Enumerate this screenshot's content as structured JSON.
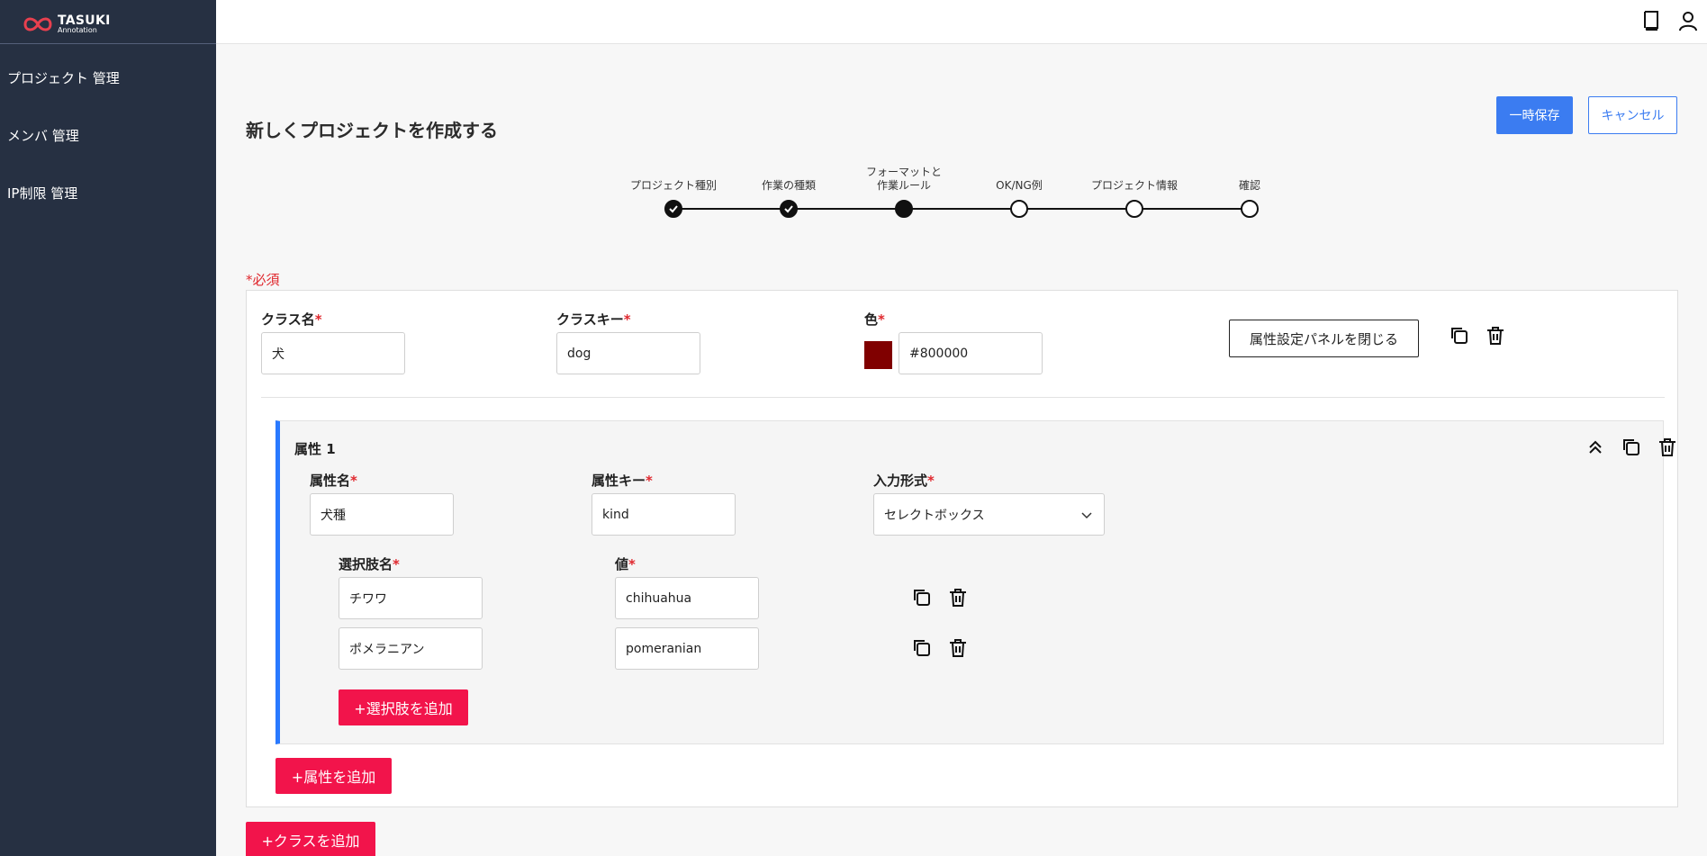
{
  "app": {
    "logo_main": "TASUKI",
    "logo_sub": "Annotation"
  },
  "sidebar": {
    "items": [
      {
        "label": "プロジェクト 管理"
      },
      {
        "label": "メンバ 管理"
      },
      {
        "label": "IP制限 管理"
      }
    ]
  },
  "header": {
    "icons": [
      "book-icon",
      "user-icon"
    ]
  },
  "page": {
    "title": "新しくプロジェクトを作成する",
    "save_label": "一時保存",
    "cancel_label": "キャンセル",
    "required_note": "*必須"
  },
  "stepper": {
    "steps": [
      {
        "label": "プロジェクト種別",
        "state": "done"
      },
      {
        "label": "作業の種類",
        "state": "done"
      },
      {
        "label_line1": "フォーマットと",
        "label_line2": "作業ルール",
        "state": "current"
      },
      {
        "label": "OK/NG例",
        "state": "todo"
      },
      {
        "label": "プロジェクト情報",
        "state": "todo"
      },
      {
        "label": "確認",
        "state": "todo"
      }
    ]
  },
  "class_card": {
    "class_name_label": "クラス名",
    "class_name_value": "犬",
    "class_key_label": "クラスキー",
    "class_key_value": "dog",
    "color_label": "色",
    "color_value": "#800000",
    "close_panel_label": "属性設定パネルを閉じる",
    "required_mark": "*",
    "attribute": {
      "title": "属性 1",
      "name_label": "属性名",
      "name_value": "犬種",
      "key_label": "属性キー",
      "key_value": "kind",
      "input_type_label": "入力形式",
      "input_type_value": "セレクトボックス",
      "option_name_label": "選択肢名",
      "option_value_label": "値",
      "options": [
        {
          "name": "チワワ",
          "value": "chihuahua"
        },
        {
          "name": "ポメラニアン",
          "value": "pomeranian"
        }
      ],
      "add_option_label": "+選択肢を追加"
    },
    "add_attribute_label": "+属性を追加"
  },
  "add_class_label": "+クラスを追加",
  "colors": {
    "sidebar": "#263042",
    "primary": "#3b7cf1",
    "accent_red": "#f2144b",
    "panel_border": "#2979ff",
    "swatch": "#800000"
  }
}
